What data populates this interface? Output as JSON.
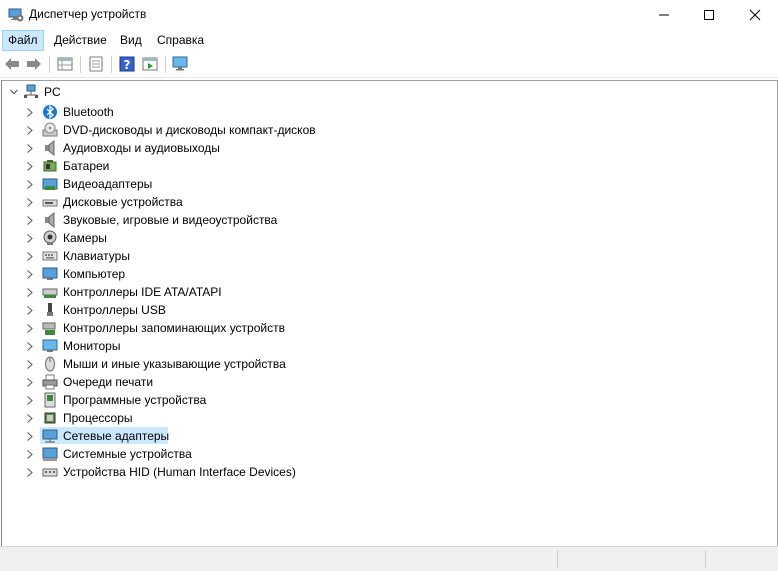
{
  "window": {
    "title": "Диспетчер устройств"
  },
  "menu": [
    {
      "label": "Файл",
      "active": true
    },
    {
      "label": "Действие"
    },
    {
      "label": "Вид"
    },
    {
      "label": "Справка"
    }
  ],
  "toolbar": [
    "back-icon",
    "forward-icon",
    "properties-grid-icon",
    "doc-icon",
    "help-icon",
    "play-grid-icon",
    "monitor-icon"
  ],
  "tree": {
    "root": {
      "label": "PC",
      "icon": "computer-icon",
      "expanded": true
    },
    "children": [
      {
        "label": "Bluetooth",
        "icon": "bluetooth-icon"
      },
      {
        "label": "DVD-дисководы и дисководы компакт-дисков",
        "icon": "dvd-drive-icon"
      },
      {
        "label": "Аудиовходы и аудиовыходы",
        "icon": "audio-io-icon"
      },
      {
        "label": "Батареи",
        "icon": "battery-icon"
      },
      {
        "label": "Видеоадаптеры",
        "icon": "display-adapter-icon"
      },
      {
        "label": "Дисковые устройства",
        "icon": "disk-drive-icon"
      },
      {
        "label": "Звуковые, игровые и видеоустройства",
        "icon": "sound-icon"
      },
      {
        "label": "Камеры",
        "icon": "camera-icon"
      },
      {
        "label": "Клавиатуры",
        "icon": "keyboard-icon"
      },
      {
        "label": "Компьютер",
        "icon": "computer-monitor-icon"
      },
      {
        "label": "Контроллеры IDE ATA/ATAPI",
        "icon": "ide-controller-icon"
      },
      {
        "label": "Контроллеры USB",
        "icon": "usb-icon"
      },
      {
        "label": "Контроллеры запоминающих устройств",
        "icon": "storage-controller-icon"
      },
      {
        "label": "Мониторы",
        "icon": "monitor-icon"
      },
      {
        "label": "Мыши и иные указывающие устройства",
        "icon": "mouse-icon"
      },
      {
        "label": "Очереди печати",
        "icon": "printer-icon"
      },
      {
        "label": "Программные устройства",
        "icon": "software-device-icon"
      },
      {
        "label": "Процессоры",
        "icon": "processor-icon"
      },
      {
        "label": "Сетевые адаптеры",
        "icon": "network-adapter-icon",
        "selected": true
      },
      {
        "label": "Системные устройства",
        "icon": "system-device-icon"
      },
      {
        "label": "Устройства HID (Human Interface Devices)",
        "icon": "hid-icon"
      }
    ]
  },
  "colors": {
    "selection": "#cce8ff",
    "selection_border": "#99d1ff",
    "accent": "#1e90ff"
  }
}
